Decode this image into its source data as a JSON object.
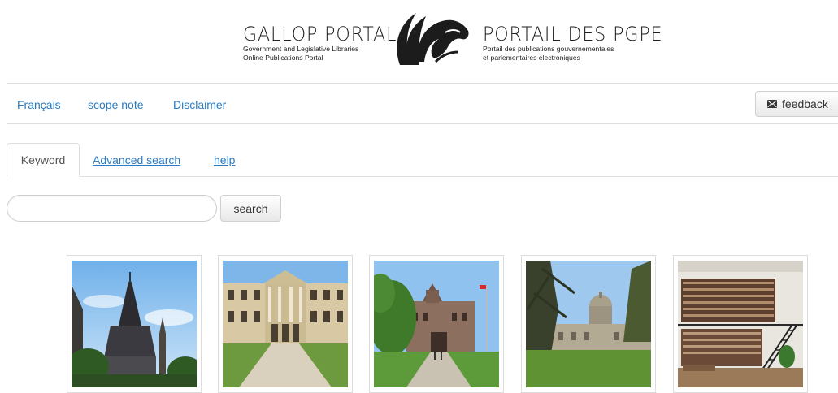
{
  "brand": {
    "title_en": "GALLOP PORTAL",
    "subtitle_en": [
      "Government and Legislative Libraries",
      "Online Publications Portal"
    ],
    "title_fr": "PORTAIL DES PGPE",
    "subtitle_fr": [
      "Portail des publications gouvernementales",
      "et parlementaires électroniques"
    ],
    "logo_icon": "horse-head-logo-icon"
  },
  "nav": {
    "francais": "Français",
    "scope_note": "scope note",
    "disclaimer": "Disclaimer",
    "feedback": "feedback",
    "feedback_icon": "envelope-icon"
  },
  "tabs": [
    {
      "label": "Keyword",
      "active": true
    },
    {
      "label": "Advanced search",
      "active": false
    },
    {
      "label": "help",
      "active": false
    }
  ],
  "search": {
    "value": "",
    "placeholder": "",
    "button_label": "search"
  },
  "gallery": [
    {
      "name": "parliament-library-photo"
    },
    {
      "name": "province-house-photo"
    },
    {
      "name": "queens-park-photo"
    },
    {
      "name": "domed-legislature-photo"
    },
    {
      "name": "library-interior-photo"
    }
  ],
  "colors": {
    "link": "#2a7bc1",
    "text": "#333333",
    "border": "#dedede",
    "sky": "#8fc2ee"
  }
}
